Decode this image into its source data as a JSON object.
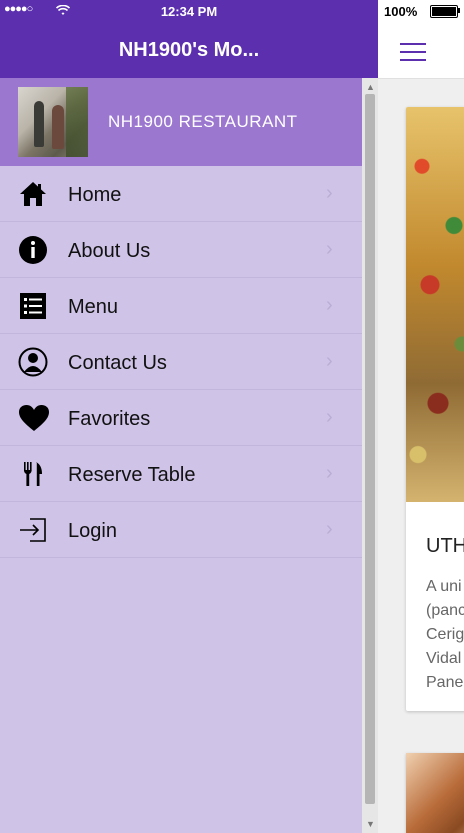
{
  "status_bar": {
    "time": "12:34 PM",
    "battery_text": "100%"
  },
  "header": {
    "title": "NH1900's Mo..."
  },
  "drawer": {
    "restaurant_name": "NH1900 RESTAURANT",
    "items": [
      {
        "label": "Home",
        "icon": "home-icon"
      },
      {
        "label": "About Us",
        "icon": "info-icon"
      },
      {
        "label": "Menu",
        "icon": "list-icon"
      },
      {
        "label": "Contact Us",
        "icon": "contact-icon"
      },
      {
        "label": "Favorites",
        "icon": "heart-icon"
      },
      {
        "label": "Reserve Table",
        "icon": "cutlery-icon"
      },
      {
        "label": "Login",
        "icon": "login-icon"
      }
    ]
  },
  "content": {
    "card_title": "UTH",
    "card_desc_lines": [
      "A uni",
      "(panc",
      "Cerig",
      "Vidal",
      "Pane"
    ]
  },
  "colors": {
    "accent": "#5b2fae",
    "drawer_bg": "#cfc3e8",
    "profile_bg": "#9b77d0"
  }
}
